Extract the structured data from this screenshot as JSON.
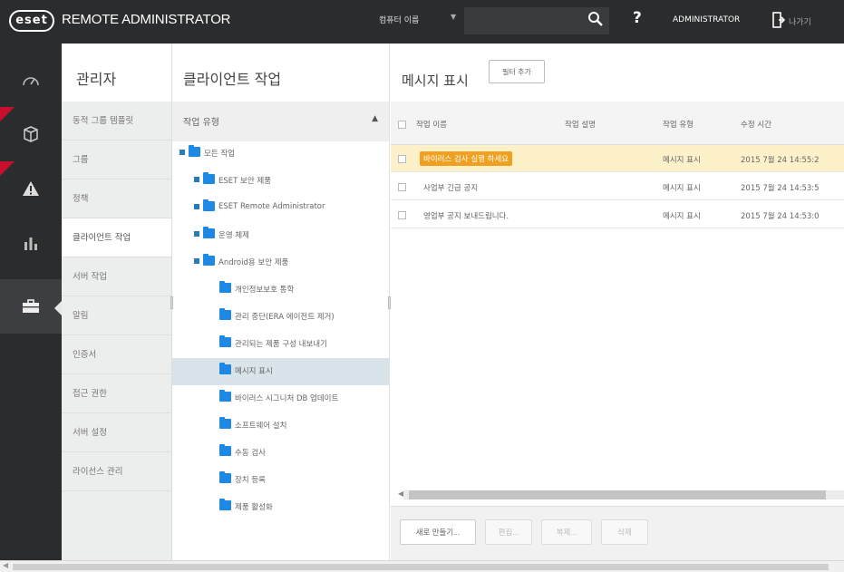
{
  "header": {
    "logo_text": "eset",
    "app_title": "REMOTE ADMINISTRATOR",
    "computer_name_label": "컴퓨터 이름",
    "search_placeholder": "",
    "help_label": "?",
    "user_label": "ADMINISTRATOR",
    "logout_label": "나가기"
  },
  "rail": {
    "items": [
      {
        "icon": "dashboard-icon",
        "active": false,
        "badge": false
      },
      {
        "icon": "computer-cube-icon",
        "active": false,
        "badge": true
      },
      {
        "icon": "warning-triangle-icon",
        "active": false,
        "badge": true
      },
      {
        "icon": "bar-chart-icon",
        "active": false,
        "badge": false
      },
      {
        "icon": "briefcase-icon",
        "active": true,
        "badge": false
      }
    ]
  },
  "categories": {
    "title": "관리자",
    "items": [
      {
        "label": "동적 그룹 템플릿",
        "active": false
      },
      {
        "label": "그룹",
        "active": false
      },
      {
        "label": "정책",
        "active": false
      },
      {
        "label": "클라이언트 작업",
        "active": true
      },
      {
        "label": "서버 작업",
        "active": false
      },
      {
        "label": "알림",
        "active": false
      },
      {
        "label": "인증서",
        "active": false
      },
      {
        "label": "접근 권한",
        "active": false
      },
      {
        "label": "서버 설정",
        "active": false
      },
      {
        "label": "라이선스 관리",
        "active": false
      }
    ]
  },
  "tree": {
    "title": "클라이언트 작업",
    "header_label": "작업 유형",
    "nodes": [
      {
        "label": "모든 작업",
        "level": 0,
        "selected": false
      },
      {
        "label": "ESET 보안 제품",
        "level": 1,
        "selected": false
      },
      {
        "label": "ESET Remote Administrator",
        "level": 1,
        "selected": false
      },
      {
        "label": "운영 체제",
        "level": 1,
        "selected": false
      },
      {
        "label": "Android용 보안 제품",
        "level": 1,
        "selected": false
      },
      {
        "label": "개인정보보호 통학",
        "level": 2,
        "selected": false
      },
      {
        "label": "관리 중단(ERA 에이전트 제거)",
        "level": 2,
        "selected": false
      },
      {
        "label": "관리되는 제품 구성 내보내기",
        "level": 2,
        "selected": false
      },
      {
        "label": "메시지 표시",
        "level": 2,
        "selected": true
      },
      {
        "label": "바이러스 시그니처 DB 업데이트",
        "level": 2,
        "selected": false
      },
      {
        "label": "소프트웨어 설치",
        "level": 2,
        "selected": false
      },
      {
        "label": "수동 검사",
        "level": 2,
        "selected": false
      },
      {
        "label": "장치 등록",
        "level": 2,
        "selected": false
      },
      {
        "label": "제품 활성화",
        "level": 2,
        "selected": false
      }
    ]
  },
  "main": {
    "title": "메시지 표시",
    "filter_button": "필터 추가",
    "columns": [
      "작업 이름",
      "작업 설명",
      "작업 유형",
      "수정 시간"
    ],
    "rows": [
      {
        "name": "바이러스 검사 실행 하세요",
        "description": "",
        "type": "메시지 표시",
        "modified": "2015 7월 24 14:55:2",
        "selected": true
      },
      {
        "name": "사업부 긴급 공지",
        "description": "",
        "type": "메시지 표시",
        "modified": "2015 7월 24 14:53:5",
        "selected": false
      },
      {
        "name": "영업부 공지 보내드립니다.",
        "description": "",
        "type": "메시지 표시",
        "modified": "2015 7월 24 14:53:0",
        "selected": false
      }
    ],
    "actions": {
      "new": "새로 만들기...",
      "edit": "편집...",
      "delete": "복제...",
      "remove": "삭제"
    }
  },
  "colors": {
    "chrome": "#2b2c2e",
    "accent_blue": "#1e88e5",
    "badge_red": "#c8102e",
    "selection_yellow": "#fdf1c9",
    "highlight_orange": "#f0a020"
  }
}
